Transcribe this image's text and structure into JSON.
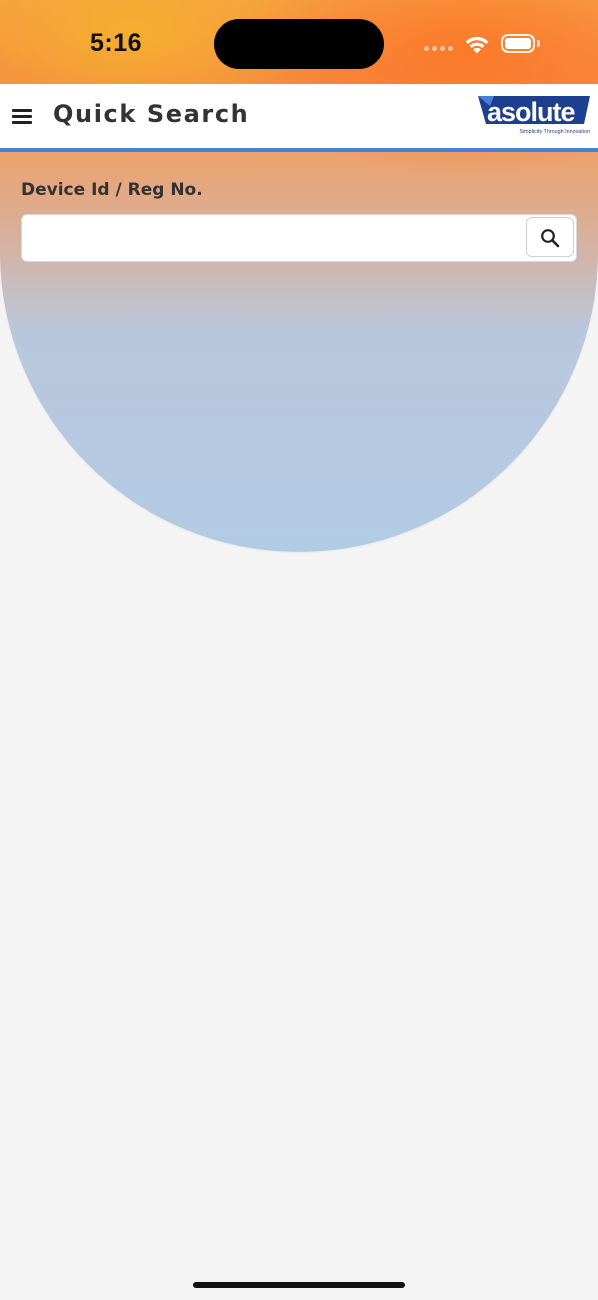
{
  "status_bar": {
    "time": "5:16",
    "icons": [
      "cellular-signal-icon",
      "wifi-icon",
      "battery-icon"
    ]
  },
  "header": {
    "menu_icon": "hamburger-menu-icon",
    "title": "Quick Search",
    "logo": {
      "wordmark": "asolute",
      "tagline": "Simplicity Through Innovation",
      "colors": {
        "primary": "#1e3f8f",
        "accent": "#4a7fd6"
      }
    }
  },
  "search_form": {
    "label": "Device Id / Reg No.",
    "input_value": "",
    "input_placeholder": "",
    "button_icon": "search-icon"
  },
  "theme": {
    "header_accent": "#4a7fd6",
    "bg_gradient": [
      "#f5a045",
      "#f58a42",
      "#b2cbe4"
    ],
    "page_bg": "#f4f4f5"
  }
}
